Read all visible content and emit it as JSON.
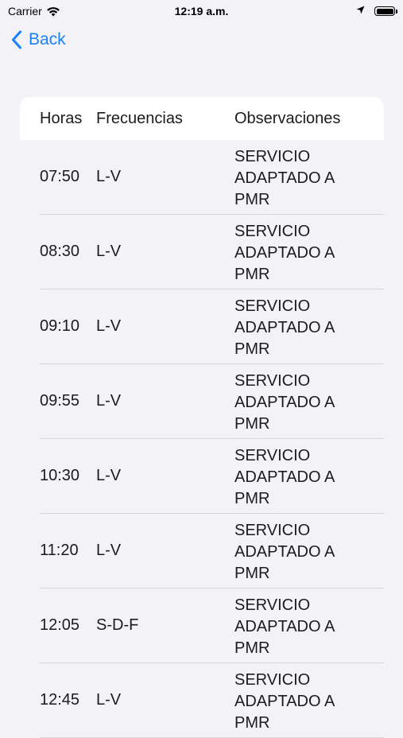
{
  "status_bar": {
    "carrier": "Carrier",
    "time": "12:19 a.m.",
    "battery_level": 1.0
  },
  "nav": {
    "back_label": "Back",
    "accent_color": "#1a82f7"
  },
  "table": {
    "headers": {
      "hora": "Horas",
      "frecuencia": "Frecuencias",
      "observaciones": "Observaciones"
    },
    "rows": [
      {
        "hora": "07:50",
        "frecuencia": "L-V",
        "observaciones": "SERVICIO ADAPTADO A PMR"
      },
      {
        "hora": "08:30",
        "frecuencia": "L-V",
        "observaciones": "SERVICIO ADAPTADO A PMR"
      },
      {
        "hora": "09:10",
        "frecuencia": "L-V",
        "observaciones": "SERVICIO ADAPTADO A PMR"
      },
      {
        "hora": "09:55",
        "frecuencia": "L-V",
        "observaciones": "SERVICIO ADAPTADO A PMR"
      },
      {
        "hora": "10:30",
        "frecuencia": "L-V",
        "observaciones": "SERVICIO ADAPTADO A PMR"
      },
      {
        "hora": "11:20",
        "frecuencia": "L-V",
        "observaciones": "SERVICIO ADAPTADO A PMR"
      },
      {
        "hora": "12:05",
        "frecuencia": "S-D-F",
        "observaciones": "SERVICIO ADAPTADO A PMR"
      },
      {
        "hora": "12:45",
        "frecuencia": "L-V",
        "observaciones": "SERVICIO ADAPTADO A PMR"
      }
    ]
  }
}
